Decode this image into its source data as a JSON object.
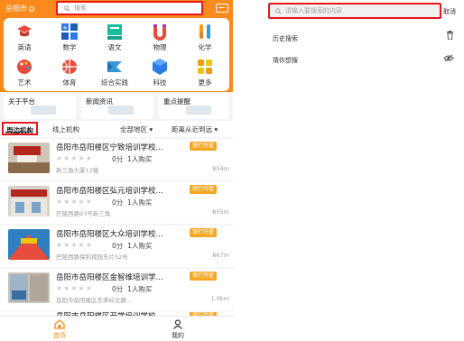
{
  "left": {
    "header": {
      "city": "岳阳市",
      "search_placeholder": "搜索"
    },
    "categories": [
      {
        "label": "英语",
        "icon": "english-icon"
      },
      {
        "label": "数学",
        "icon": "math-icon"
      },
      {
        "label": "语文",
        "icon": "chinese-icon"
      },
      {
        "label": "物理",
        "icon": "physics-icon"
      },
      {
        "label": "化学",
        "icon": "chemistry-icon"
      },
      {
        "label": "艺术",
        "icon": "art-icon"
      },
      {
        "label": "体育",
        "icon": "sports-icon"
      },
      {
        "label": "综合实践",
        "icon": "practice-icon"
      },
      {
        "label": "科技",
        "icon": "tech-icon"
      },
      {
        "label": "更多",
        "icon": "more-icon"
      }
    ],
    "quick_links": [
      "关于平台",
      "新闻资讯",
      "重点提醒"
    ],
    "tabs": {
      "nearby": "周边机构",
      "online": "线上机构"
    },
    "filters": {
      "region": "全部地区 ▾",
      "sort": "距离从近到远 ▾"
    },
    "institutions": [
      {
        "name": "岳阳市岳阳楼区宁致培训学校...",
        "badge": "银行托管",
        "stars": "★★★★★",
        "score": "0分",
        "buyers": "1人购买",
        "address": "新三角大厦12楼",
        "distance": "854m"
      },
      {
        "name": "岳阳市岳阳楼区弘元培训学校...",
        "badge": "银行托管",
        "stars": "★★★★★",
        "score": "0分",
        "buyers": "1人购买",
        "address": "巴陵西路93号新三角",
        "distance": "855m"
      },
      {
        "name": "岳阳市岳阳楼区大众培训学校...",
        "badge": "银行托管",
        "stars": "★★★★★",
        "score": "0分",
        "buyers": "1人购买",
        "address": "巴陵西路保利观园东片52号",
        "distance": "867m"
      },
      {
        "name": "岳阳市岳阳楼区金智维培训学...",
        "badge": "银行托管",
        "stars": "★★★★★",
        "score": "0分",
        "buyers": "1人购买",
        "address": "岳阳市岳阳楼区东茅岭北路...",
        "distance": "1.0km"
      },
      {
        "name": "岳阳市岳阳楼区开学培训学校",
        "badge": "银行托管",
        "stars": "",
        "score": "",
        "buyers": "",
        "address": "",
        "distance": ""
      }
    ],
    "bottom_nav": {
      "home": "首页",
      "me": "我的"
    }
  },
  "right": {
    "search_placeholder": "请输入要搜索的内容",
    "cancel": "取消",
    "history": "历史搜索",
    "guess": "猜你想搜"
  },
  "colors": {
    "accent": "#fb8a1c",
    "highlight": "#e8171c",
    "badge": "#f5a623"
  }
}
